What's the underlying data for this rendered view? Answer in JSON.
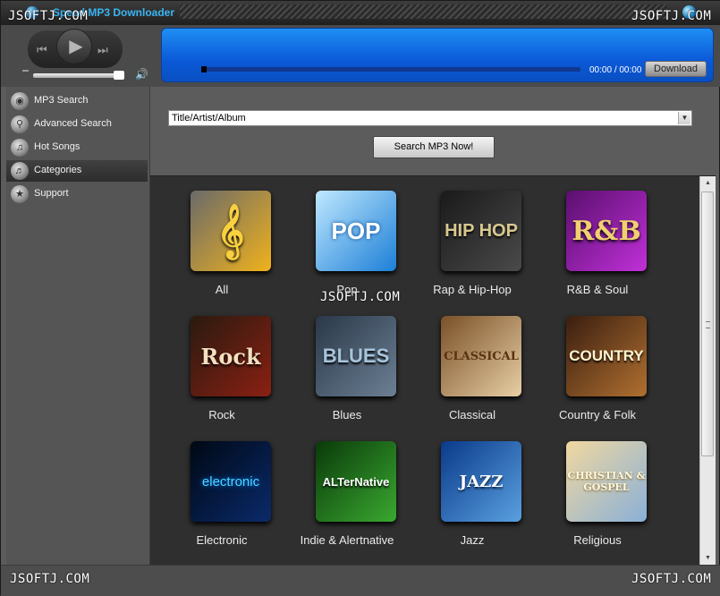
{
  "titlebar": {
    "app_title": "Speed MP3 Downloader"
  },
  "watermark": {
    "text": "JSOFTJ.COM",
    "text_right": "JSOFTJ.COM",
    "text_bottom_right": "JSOFTJ.COM"
  },
  "player": {
    "time_current": "00:00",
    "time_separator": "/",
    "time_total": "00:00",
    "download_label": "Download",
    "progress_fraction": 0,
    "volume_fraction": 0.9,
    "prev_icon": "skip-back-icon",
    "play_icon": "play-icon",
    "next_icon": "skip-forward-icon",
    "speaker_icon": "speaker-icon"
  },
  "sidebar": {
    "items": [
      {
        "label": "MP3 Search",
        "icon": "disc-icon",
        "active": false
      },
      {
        "label": "Advanced Search",
        "icon": "magnifier-icon",
        "active": false
      },
      {
        "label": "Hot Songs",
        "icon": "headphones-icon",
        "active": false
      },
      {
        "label": "Categories",
        "icon": "music-icon",
        "active": true
      },
      {
        "label": "Support",
        "icon": "star-icon",
        "active": false
      }
    ]
  },
  "search": {
    "select_value": "Title/Artist/Album",
    "button_label": "Search MP3 Now!"
  },
  "categories": [
    {
      "label": "All",
      "tile_text": "",
      "colors": [
        "#6a6a6a",
        "#f0b21c"
      ]
    },
    {
      "label": "Pop",
      "tile_text": "POP",
      "colors": [
        "#bfe8ff",
        "#1c7fd6"
      ]
    },
    {
      "label": "Rap & Hip-Hop",
      "tile_text": "HIP HOP",
      "colors": [
        "#1a1a1a",
        "#4a4a4a"
      ]
    },
    {
      "label": "R&B & Soul",
      "tile_text": "R&B",
      "colors": [
        "#5a0f6e",
        "#c030d8"
      ]
    },
    {
      "label": "Rock",
      "tile_text": "Rock",
      "colors": [
        "#2a1a10",
        "#8a2012"
      ]
    },
    {
      "label": "Blues",
      "tile_text": "BLUES",
      "colors": [
        "#2a3848",
        "#6c8094"
      ]
    },
    {
      "label": "Classical",
      "tile_text": "CLASSICAL",
      "colors": [
        "#7a5028",
        "#e8cfa4"
      ]
    },
    {
      "label": "Country & Folk",
      "tile_text": "COUNTRY",
      "colors": [
        "#3a1e10",
        "#b07030"
      ]
    },
    {
      "label": "Electronic",
      "tile_text": "electronic",
      "colors": [
        "#000814",
        "#0a2a6a"
      ]
    },
    {
      "label": "Indie & Alertnative",
      "tile_text": "ALTerNative",
      "colors": [
        "#0a3a0a",
        "#3aa830"
      ]
    },
    {
      "label": "Jazz",
      "tile_text": "JAZZ",
      "colors": [
        "#0a3a8a",
        "#5aa0e0"
      ]
    },
    {
      "label": "Religious",
      "tile_text": "CHRISTIAN & GOSPEL",
      "colors": [
        "#f0d8a0",
        "#8ab0d8"
      ]
    }
  ],
  "statusbar": {
    "text": ""
  }
}
